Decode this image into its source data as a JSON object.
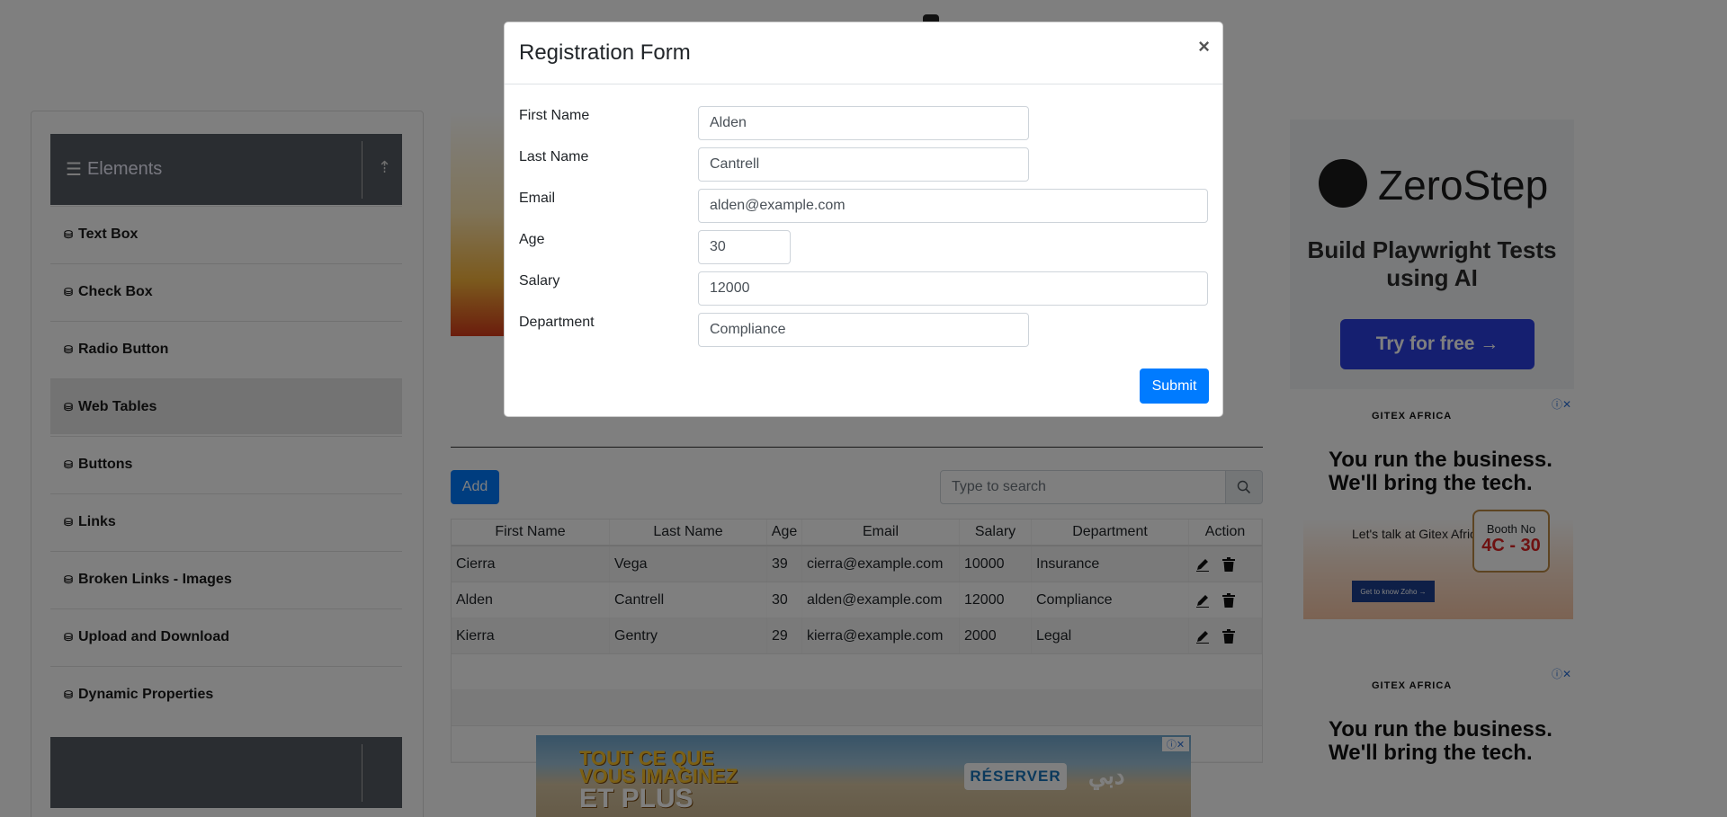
{
  "sidebar": {
    "group_title": "Elements",
    "items": [
      {
        "label": "Text Box"
      },
      {
        "label": "Check Box"
      },
      {
        "label": "Radio Button"
      },
      {
        "label": "Web Tables"
      },
      {
        "label": "Buttons"
      },
      {
        "label": "Links"
      },
      {
        "label": "Broken Links - Images"
      },
      {
        "label": "Upload and Download"
      },
      {
        "label": "Dynamic Properties"
      }
    ],
    "active_item": "Web Tables"
  },
  "table_toolbar": {
    "add_label": "Add",
    "search_placeholder": "Type to search"
  },
  "table": {
    "headers": [
      "First Name",
      "Last Name",
      "Age",
      "Email",
      "Salary",
      "Department",
      "Action"
    ],
    "rows": [
      {
        "first": "Cierra",
        "last": "Vega",
        "age": "39",
        "email": "cierra@example.com",
        "salary": "10000",
        "dept": "Insurance"
      },
      {
        "first": "Alden",
        "last": "Cantrell",
        "age": "30",
        "email": "alden@example.com",
        "salary": "12000",
        "dept": "Compliance"
      },
      {
        "first": "Kierra",
        "last": "Gentry",
        "age": "29",
        "email": "kierra@example.com",
        "salary": "2000",
        "dept": "Legal"
      }
    ]
  },
  "modal": {
    "title": "Registration Form",
    "close_label": "×",
    "fields": {
      "first_name": {
        "label": "First Name",
        "value": "Alden"
      },
      "last_name": {
        "label": "Last Name",
        "value": "Cantrell"
      },
      "email": {
        "label": "Email",
        "value": "alden@example.com"
      },
      "age": {
        "label": "Age",
        "value": "30"
      },
      "salary": {
        "label": "Salary",
        "value": "12000"
      },
      "department": {
        "label": "Department",
        "value": "Compliance"
      }
    },
    "submit_label": "Submit"
  },
  "ads": {
    "zerostep": {
      "brand": "ZeroStep",
      "headline": "Build Playwright Tests using AI",
      "cta": "Try for free →"
    },
    "gitex": {
      "brand": "GITEX AFRICA",
      "headline": "You run the business. We'll bring the tech.",
      "talk": "Let's talk at Gitex Africa",
      "booth_label": "Booth No",
      "booth_number": "4C - 30",
      "cta": "Get to know Zoho →"
    },
    "bottom": {
      "line1": "TOUT CE QUE",
      "line2": "VOUS IMAGINEZ",
      "line3": "ET PLUS",
      "cta": "RÉSERVER",
      "brand": "دبي"
    }
  },
  "colors": {
    "primary": "#007bff",
    "sidebar_header": "#555b62",
    "overlay": "rgba(0,0,0,0.5)"
  }
}
